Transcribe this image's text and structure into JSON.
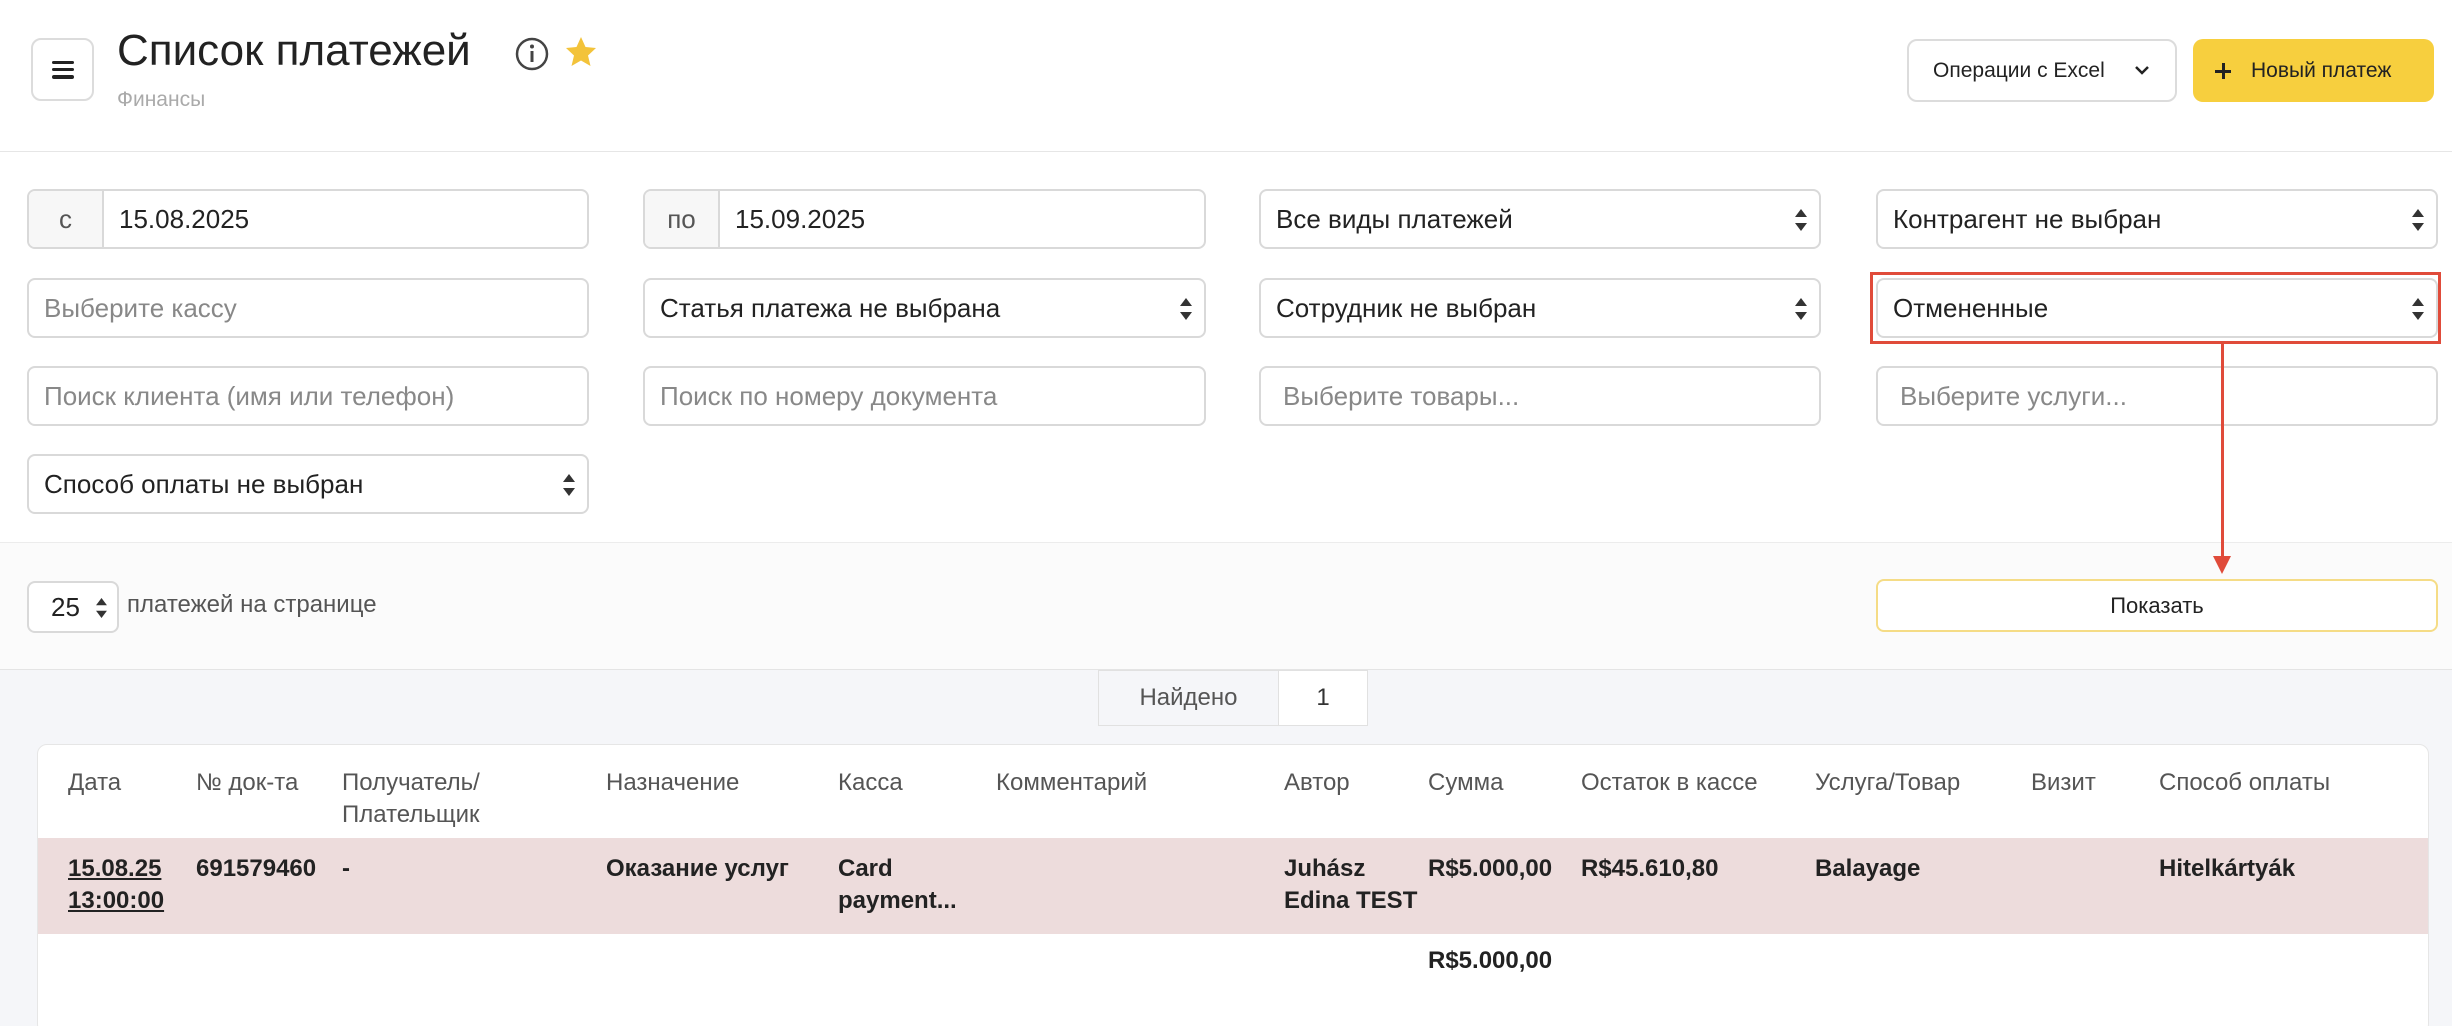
{
  "header": {
    "title": "Список платежей",
    "breadcrumb": "Финансы",
    "excel_label": "Операции с Excel",
    "new_payment_label": "Новый платеж"
  },
  "filters": {
    "date_from_prefix": "с",
    "date_from": "15.08.2025",
    "date_to_prefix": "по",
    "date_to": "15.09.2025",
    "payment_type": "Все виды платежей",
    "counterparty": "Контрагент не выбран",
    "cashbox_placeholder": "Выберите кассу",
    "payment_item": "Статья платежа не выбрана",
    "employee": "Сотрудник не выбран",
    "status": "Отмененные",
    "client_search_placeholder": "Поиск клиента (имя или телефон)",
    "doc_search_placeholder": "Поиск по номеру документа",
    "goods_placeholder": "Выберите товары...",
    "services_placeholder": "Выберите услуги...",
    "payment_method": "Способ оплаты не выбран"
  },
  "pagination": {
    "per_page": "25",
    "per_page_label": "платежей на странице",
    "show_label": "Показать"
  },
  "results": {
    "found_label": "Найдено",
    "found_count": "1"
  },
  "table": {
    "columns": [
      "Дата",
      "№ док-та",
      "Получатель/\nПлательщик",
      "Назначение",
      "Касса",
      "Комментарий",
      "Автор",
      "Сумма",
      "Остаток в кассе",
      "Услуга/Товар",
      "Визит",
      "Способ оплаты"
    ],
    "rows": [
      {
        "date": "15.08.25\n13:00:00",
        "doc": "691579460",
        "payer": "-",
        "purpose": "Оказание услуг",
        "cashbox": "Card\npayment...",
        "comment": "",
        "author": "Juhász\nEdina TEST",
        "amount": "R$5.000,00",
        "balance": "R$45.610,80",
        "service": "Balayage",
        "visit": "",
        "method": "Hitelkártyák"
      }
    ],
    "total": "R$5.000,00"
  },
  "colors": {
    "accent": "#f7cf3e",
    "highlight": "#e04b3a",
    "cancelled_row": "#eddcdc"
  }
}
